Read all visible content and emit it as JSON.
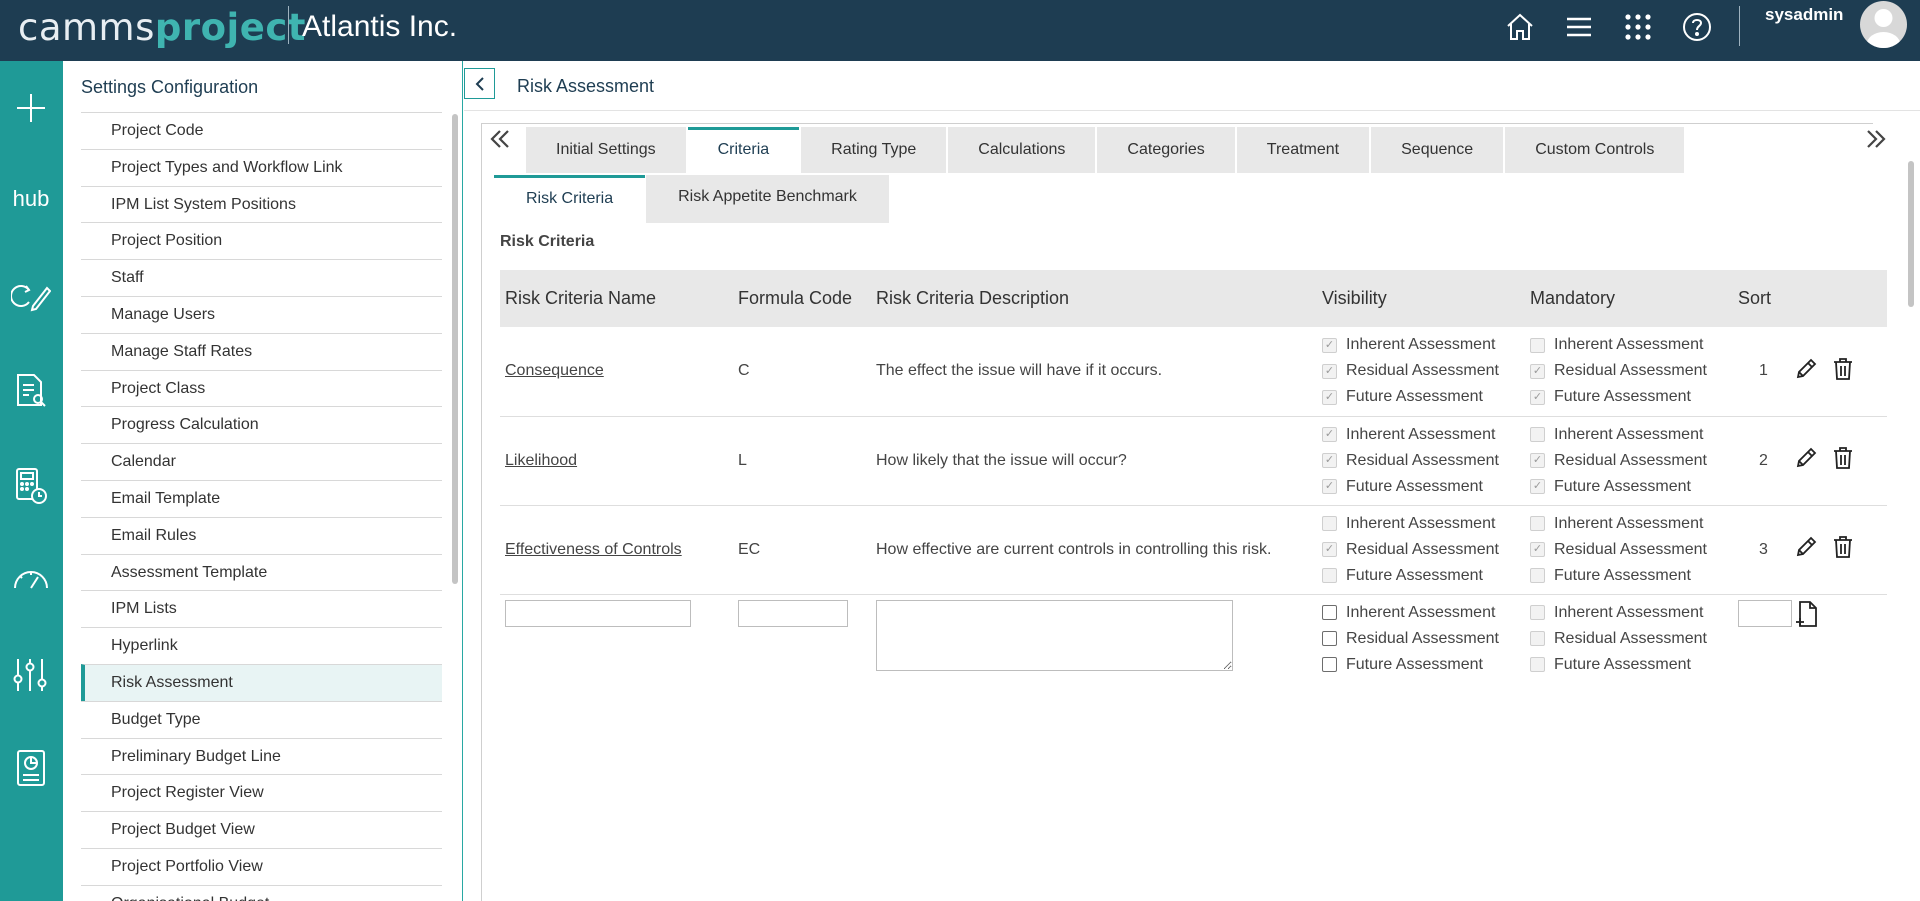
{
  "app": {
    "logo_part1": "camms",
    "logo_part2": "project",
    "company": "Atlantis Inc.",
    "username": "sysadmin",
    "top_icons": [
      "home-icon",
      "menu-icon",
      "apps-grid-icon",
      "help-icon"
    ]
  },
  "rail": {
    "items": [
      "add-icon",
      "hub-icon",
      "edit-cycle-icon",
      "document-search-icon",
      "calculator-clock-icon",
      "gauge-icon",
      "settings-sliders-icon",
      "report-icon"
    ],
    "hub_label": "hub"
  },
  "settings": {
    "title": "Settings Configuration",
    "items": [
      "Project Code",
      "Project Types and Workflow Link",
      "IPM List System Positions",
      "Project Position",
      "Staff",
      "Manage Users",
      "Manage Staff Rates",
      "Project Class",
      "Progress Calculation",
      "Calendar",
      "Email Template",
      "Email Rules",
      "Assessment Template",
      "IPM Lists",
      "Hyperlink",
      "Risk Assessment",
      "Budget Type",
      "Preliminary Budget Line",
      "Project Register View",
      "Project Budget View",
      "Project Portfolio View",
      "Organisational Budget"
    ],
    "active_item": "Risk Assessment"
  },
  "main": {
    "title": "Risk Assessment",
    "tabs": [
      "Initial Settings",
      "Criteria",
      "Rating Type",
      "Calculations",
      "Categories",
      "Treatment",
      "Sequence",
      "Custom Controls"
    ],
    "active_tab": "Criteria",
    "subtabs": [
      "Risk Criteria",
      "Risk Appetite Benchmark"
    ],
    "active_subtab": "Risk Criteria",
    "section_title": "Risk Criteria"
  },
  "table": {
    "headers": {
      "name": "Risk Criteria Name",
      "code": "Formula Code",
      "description": "Risk Criteria Description",
      "visibility": "Visibility",
      "mandatory": "Mandatory",
      "sort": "Sort"
    },
    "option_labels": [
      "Inherent Assessment",
      "Residual Assessment",
      "Future Assessment"
    ],
    "rows": [
      {
        "name": "Consequence",
        "code": "C",
        "description": "The effect the issue will have if it occurs.",
        "visibility": [
          true,
          true,
          true
        ],
        "mandatory": [
          false,
          true,
          true
        ],
        "sort": "1"
      },
      {
        "name": "Likelihood",
        "code": "L",
        "description": "How likely that the issue will occur?",
        "visibility": [
          true,
          true,
          true
        ],
        "mandatory": [
          false,
          true,
          true
        ],
        "sort": "2"
      },
      {
        "name": "Effectiveness of Controls",
        "code": "EC",
        "description": "How effective are current controls in controlling this risk.",
        "visibility": [
          false,
          true,
          false
        ],
        "mandatory": [
          false,
          true,
          false
        ],
        "sort": "3"
      }
    ],
    "new_row": {
      "name_value": "",
      "code_value": "",
      "description_value": "",
      "sort_value": ""
    }
  },
  "colors": {
    "topbar": "#1e3d52",
    "rail": "#1f9a97",
    "accent": "#1f9a97"
  }
}
